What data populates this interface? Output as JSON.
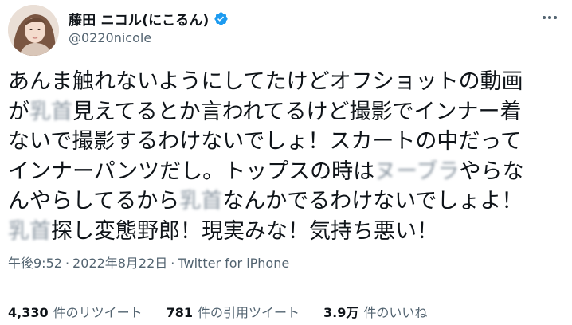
{
  "author": {
    "display_name": "藤田 ニコル(にこるん)",
    "handle": "@0220nicole",
    "verified_color": "#1d9bf0"
  },
  "tweet": {
    "lines": [
      [
        {
          "t": "あんま触れないようにしてたけどオフショットの動画"
        }
      ],
      [
        {
          "t": "が"
        },
        {
          "t": "乳首",
          "blur": true
        },
        {
          "t": "見えてるとか言われてるけど撮影でインナー着"
        }
      ],
      [
        {
          "t": "ないで撮影するわけないでしょ！スカートの中だって"
        }
      ],
      [
        {
          "t": "インナーパンツだし。トップスの時は"
        },
        {
          "t": "ヌーブラ",
          "blur": true
        },
        {
          "t": "やらな"
        }
      ],
      [
        {
          "t": "んやらしてるから"
        },
        {
          "t": "乳首",
          "blur": true
        },
        {
          "t": "なんかでるわけないでしょよ！"
        }
      ],
      [
        {
          "t": "乳首",
          "blur": true
        },
        {
          "t": "探し変態野郎！現実みな！気持ち悪い！"
        }
      ]
    ]
  },
  "meta": {
    "time": "午後9:52",
    "separator": "·",
    "date": "2022年8月22日",
    "source": "Twitter for iPhone"
  },
  "stats": {
    "retweets_count": "4,330",
    "retweets_label": "件のリツイート",
    "quotes_count": "781",
    "quotes_label": "件の引用ツイート",
    "likes_count": "3.9万",
    "likes_label": "件のいいね"
  },
  "icons": {
    "more": "more-options-icon",
    "verified": "verified-badge-icon"
  }
}
